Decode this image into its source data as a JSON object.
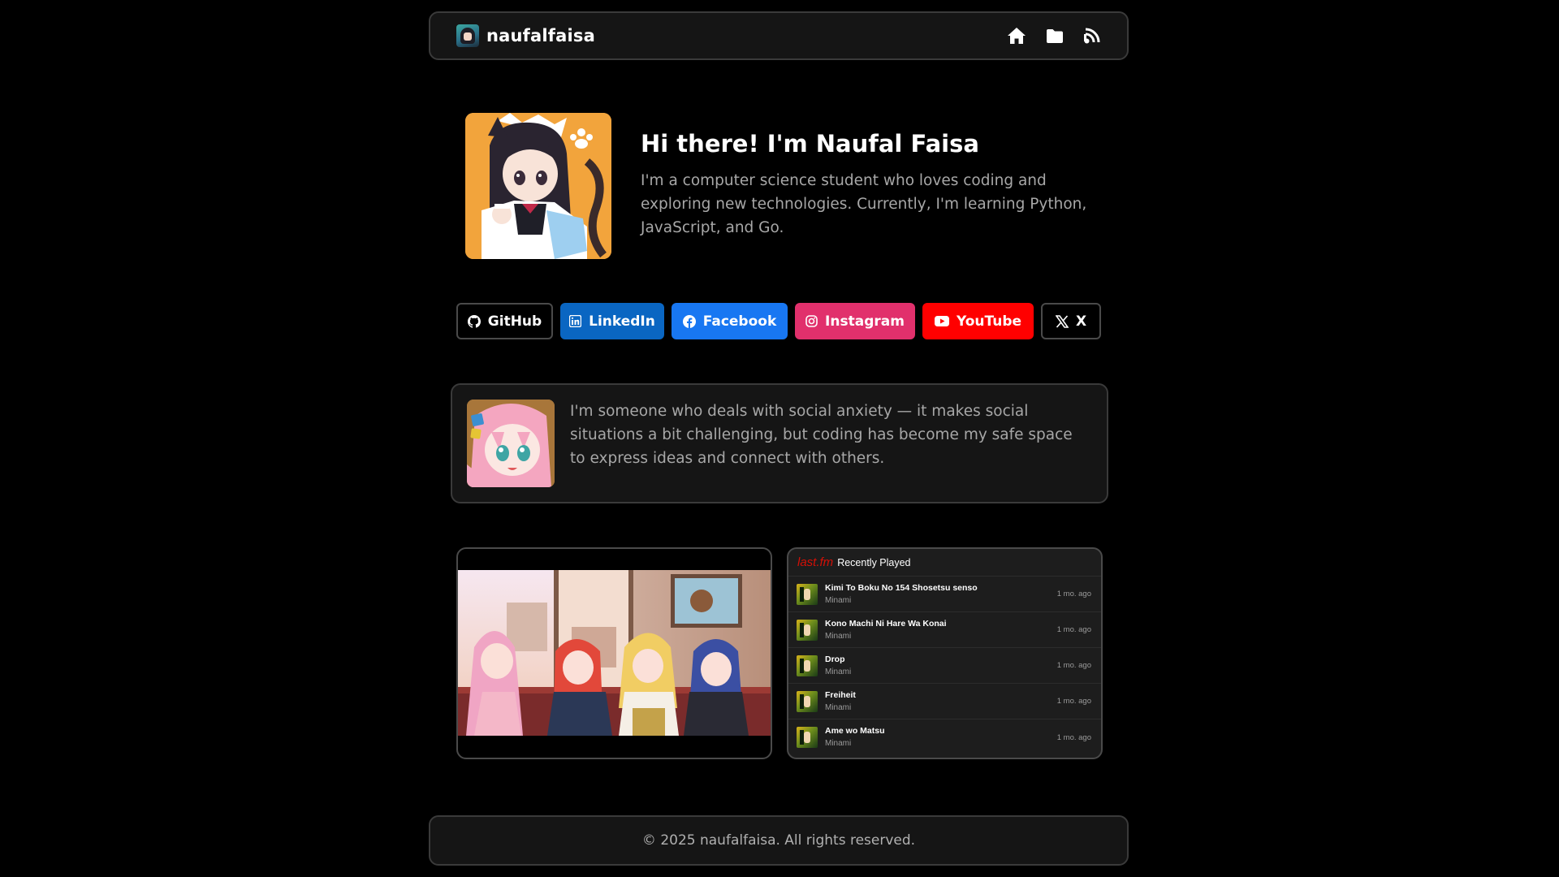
{
  "brand": {
    "name": "naufalfaisa"
  },
  "nav": {
    "icons": [
      "home-icon",
      "folder-icon",
      "blog-icon"
    ]
  },
  "hero": {
    "title": "Hi there! I'm Naufal Faisa",
    "text": "I'm a computer science student who loves coding and exploring new technologies. Currently, I'm learning Python, JavaScript, and Go."
  },
  "socials": [
    {
      "label": "GitHub",
      "icon": "github-icon",
      "color": "#000000"
    },
    {
      "label": "LinkedIn",
      "icon": "linkedin-icon",
      "color": "#0a66c2"
    },
    {
      "label": "Facebook",
      "icon": "facebook-icon",
      "color": "#1877f2"
    },
    {
      "label": "Instagram",
      "icon": "instagram-icon",
      "color": "#e1306c"
    },
    {
      "label": "YouTube",
      "icon": "youtube-icon",
      "color": "#ff0000"
    },
    {
      "label": "X",
      "icon": "x-icon",
      "color": "#000000"
    }
  ],
  "about": {
    "text": "I'm someone who deals with social anxiety — it makes social situations a bit challenging, but coding has become my safe space to express ideas and connect with others."
  },
  "lastfm": {
    "logo": "last.fm",
    "title": "Recently Played",
    "tracks": [
      {
        "title": "Kimi To Boku No 154 Shosetsu senso",
        "artist": "Minami",
        "time": "1 mo. ago"
      },
      {
        "title": "Kono Machi Ni Hare Wa Konai",
        "artist": "Minami",
        "time": "1 mo. ago"
      },
      {
        "title": "Drop",
        "artist": "Minami",
        "time": "1 mo. ago"
      },
      {
        "title": "Freiheit",
        "artist": "Minami",
        "time": "1 mo. ago"
      },
      {
        "title": "Ame wo Matsu",
        "artist": "Minami",
        "time": "1 mo. ago"
      }
    ]
  },
  "footer": {
    "text": "© 2025 naufalfaisa. All rights reserved."
  },
  "colors": {
    "background": "#000000",
    "card": "#151515",
    "border": "#3a3a3a",
    "muted_text": "#a7a7a7",
    "lastfm_red": "#d51007"
  }
}
